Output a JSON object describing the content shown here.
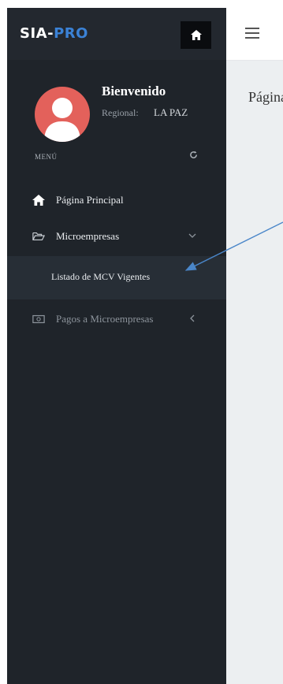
{
  "brand": {
    "part1": "SIA-",
    "part2": "PRO"
  },
  "profile": {
    "welcome": "Bienvenido",
    "region_label": "Regional:",
    "region_value": "LA PAZ"
  },
  "menu": {
    "header": "MENÚ",
    "items": [
      {
        "label": "Página Principal",
        "icon": "home-icon"
      },
      {
        "label": "Microempresas",
        "icon": "folder-open-icon"
      },
      {
        "label": "Listado de MCV Vigentes"
      },
      {
        "label": "Pagos a Microempresas",
        "icon": "money-icon"
      }
    ]
  },
  "content": {
    "page_label": "Página Principal"
  },
  "colors": {
    "sidebar": "#1f242a",
    "accent": "#3b82d6",
    "avatar": "#e3615b",
    "arrow": "#4a86c9"
  }
}
